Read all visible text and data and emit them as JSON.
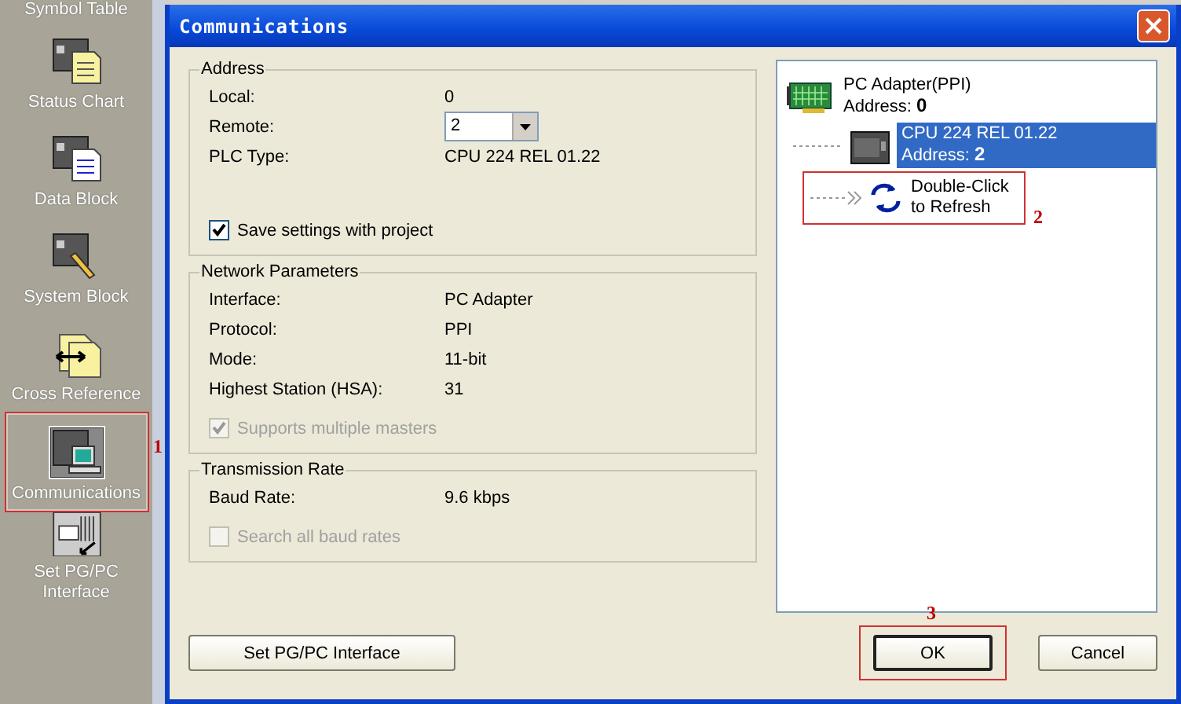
{
  "sidebar": {
    "items": [
      {
        "label": "Symbol Table",
        "selected": false
      },
      {
        "label": "Status Chart",
        "selected": false
      },
      {
        "label": "Data Block",
        "selected": false
      },
      {
        "label": "System Block",
        "selected": false
      },
      {
        "label": "Cross Reference",
        "selected": false
      },
      {
        "label": "Communications",
        "selected": true,
        "callout": "1"
      },
      {
        "label": "Set PG/PC Interface",
        "selected": false
      }
    ]
  },
  "dialog": {
    "title": "Communications",
    "groups": [
      {
        "legend": "Address",
        "rows": [
          {
            "kind": "text",
            "label": "Local:",
            "value": "0"
          },
          {
            "kind": "select",
            "label": "Remote:",
            "value": "2"
          },
          {
            "kind": "text",
            "label": "PLC Type:",
            "value": "CPU 224 REL 01.22"
          },
          {
            "kind": "checkbox",
            "label": "Save settings with project",
            "checked": true,
            "disabled": false
          }
        ]
      },
      {
        "legend": "Network Parameters",
        "rows": [
          {
            "kind": "text",
            "label": "Interface:",
            "value": "PC Adapter"
          },
          {
            "kind": "text",
            "label": "Protocol:",
            "value": "PPI"
          },
          {
            "kind": "text",
            "label": "Mode:",
            "value": "11-bit"
          },
          {
            "kind": "text",
            "label": "Highest Station (HSA):",
            "value": "31"
          },
          {
            "kind": "checkbox",
            "label": "Supports multiple masters",
            "checked": true,
            "disabled": true
          }
        ]
      },
      {
        "legend": "Transmission Rate",
        "rows": [
          {
            "kind": "text",
            "label": "Baud Rate:",
            "value": "9.6 kbps"
          },
          {
            "kind": "checkbox",
            "label": "Search all baud rates",
            "checked": false,
            "disabled": true
          }
        ]
      }
    ],
    "tree": [
      {
        "kind": "adapter",
        "title": "PC Adapter(PPI)",
        "subtitle": "Address: **0**",
        "selected": false,
        "children": [
          {
            "kind": "cpu",
            "title": "CPU 224 REL 01.22",
            "subtitle": "Address: **2**",
            "selected": true
          },
          {
            "kind": "refresh",
            "title": "Double-Click",
            "subtitle": "to Refresh",
            "selected": false,
            "callout": "2"
          }
        ]
      }
    ],
    "interface_button": "Set PG/PC Interface",
    "buttons": [
      {
        "label": "OK",
        "default": true,
        "callout": "3"
      },
      {
        "label": "Cancel",
        "default": false
      }
    ]
  }
}
